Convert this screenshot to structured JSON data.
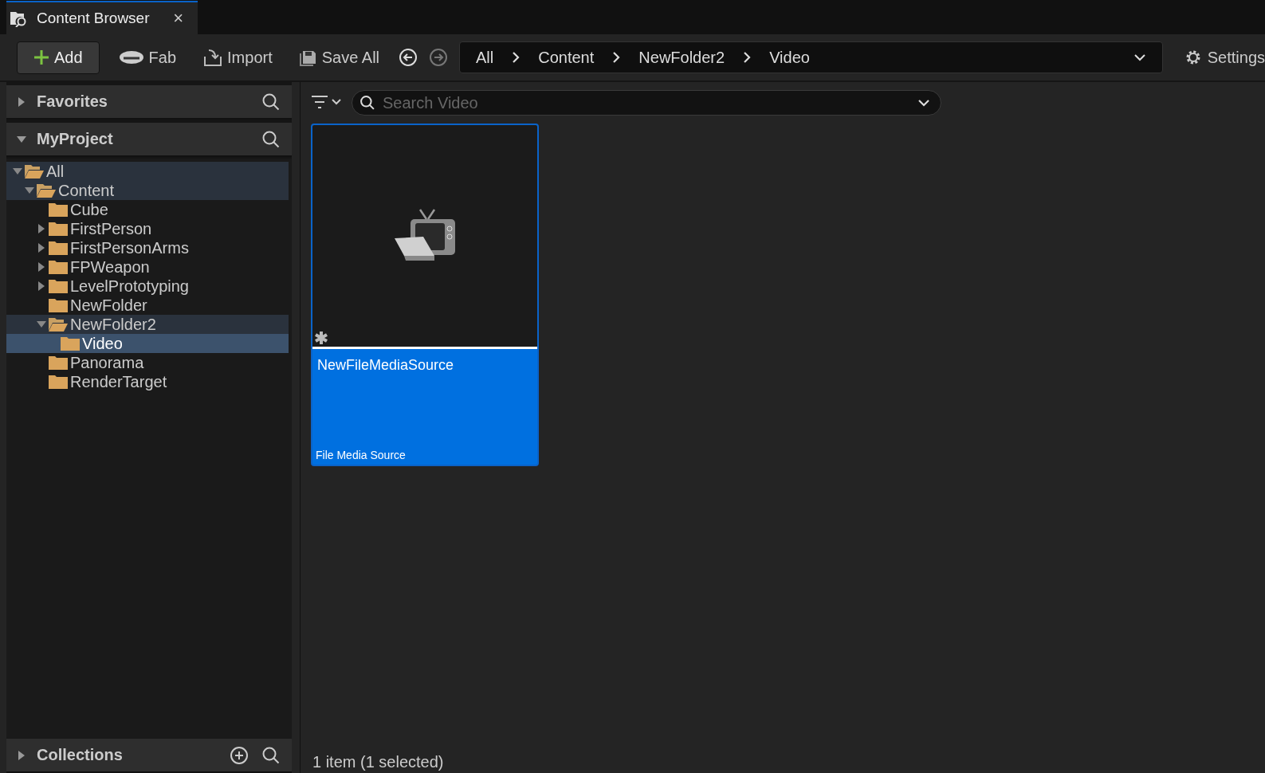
{
  "tab": {
    "title": "Content Browser",
    "close": "×"
  },
  "toolbar": {
    "buttons": [
      {
        "label": "Add",
        "kind": "add"
      },
      {
        "label": "Fab",
        "kind": "fab"
      },
      {
        "label": "Import",
        "kind": "import"
      },
      {
        "label": "Save All",
        "kind": "save"
      }
    ],
    "breadcrumbs": [
      "All",
      "Content",
      "NewFolder2",
      "Video"
    ],
    "settings": "Settings"
  },
  "sidebar": {
    "sections": [
      {
        "title": "Favorites",
        "expanded": false
      },
      {
        "title": "MyProject",
        "expanded": true
      }
    ],
    "tree": [
      {
        "label": "All",
        "expanded": true,
        "highlighted": true,
        "selected": false,
        "children": [
          {
            "label": "Content",
            "expanded": true,
            "highlighted": true,
            "selected": false,
            "children": [
              {
                "label": "Cube",
                "expanded": false,
                "has_children": false,
                "highlighted": false,
                "selected": false
              },
              {
                "label": "FirstPerson",
                "expanded": false,
                "has_children": true,
                "highlighted": false,
                "selected": false
              },
              {
                "label": "FirstPersonArms",
                "expanded": false,
                "has_children": true,
                "highlighted": false,
                "selected": false
              },
              {
                "label": "FPWeapon",
                "expanded": false,
                "has_children": true,
                "highlighted": false,
                "selected": false
              },
              {
                "label": "LevelPrototyping",
                "expanded": false,
                "has_children": true,
                "highlighted": false,
                "selected": false
              },
              {
                "label": "NewFolder",
                "expanded": false,
                "has_children": false,
                "highlighted": false,
                "selected": false
              },
              {
                "label": "NewFolder2",
                "expanded": true,
                "highlighted": true,
                "selected": false,
                "children": [
                  {
                    "label": "Video",
                    "expanded": false,
                    "has_children": false,
                    "highlighted": false,
                    "selected": true
                  }
                ]
              },
              {
                "label": "Panorama",
                "expanded": false,
                "has_children": false,
                "highlighted": false,
                "selected": false
              },
              {
                "label": "RenderTarget",
                "expanded": false,
                "has_children": false,
                "highlighted": false,
                "selected": false
              }
            ]
          }
        ]
      }
    ],
    "collections": {
      "title": "Collections",
      "expanded": false
    }
  },
  "content": {
    "search": {
      "placeholder": "Search Video"
    },
    "assets": [
      {
        "name": "NewFileMediaSource",
        "type": "File Media Source",
        "selected": true
      }
    ],
    "status": "1 item (1 selected)"
  }
}
